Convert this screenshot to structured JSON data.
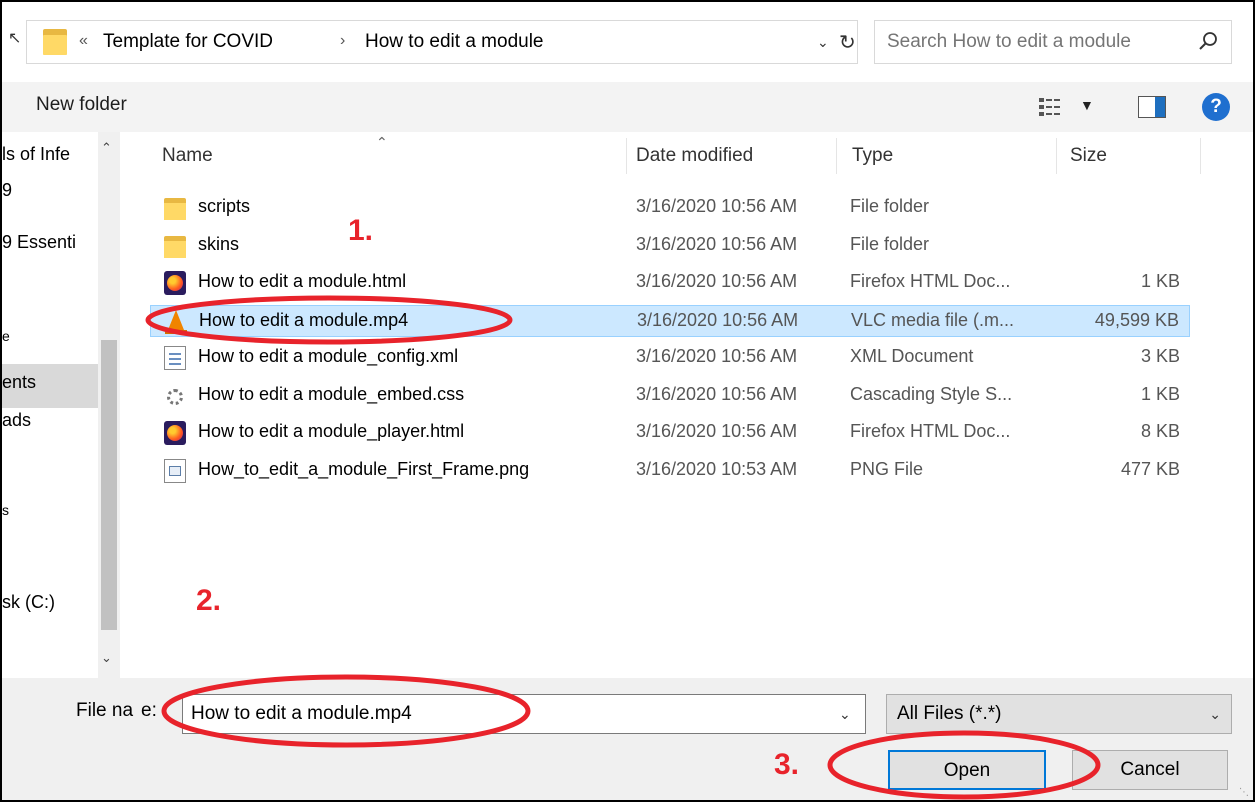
{
  "address": {
    "chevron": "«",
    "crumbs": [
      "Template for COVID",
      "How to edit a module"
    ],
    "separator": "›",
    "refresh_icon": "refresh-icon"
  },
  "search": {
    "placeholder": "Search How to edit a module"
  },
  "toolbar": {
    "new_folder_label": "New folder"
  },
  "nav": {
    "items": [
      {
        "label": "ls of Infe"
      },
      {
        "label": "9"
      },
      {
        "label": "9 Essenti"
      },
      {
        "label": "e"
      },
      {
        "label": "ents"
      },
      {
        "label": "ads"
      },
      {
        "label": "s"
      },
      {
        "label": "sk (C:)"
      }
    ],
    "selected_index": 4
  },
  "columns": {
    "name": "Name",
    "date": "Date modified",
    "type": "Type",
    "size": "Size"
  },
  "files": [
    {
      "name": "scripts",
      "date": "3/16/2020 10:56 AM",
      "type": "File folder",
      "size": "",
      "icon": "folder-icon"
    },
    {
      "name": "skins",
      "date": "3/16/2020 10:56 AM",
      "type": "File folder",
      "size": "",
      "icon": "folder-icon"
    },
    {
      "name": "How to edit a module.html",
      "date": "3/16/2020 10:56 AM",
      "type": "Firefox HTML Doc...",
      "size": "1 KB",
      "icon": "firefox-icon"
    },
    {
      "name": "How to edit a module.mp4",
      "date": "3/16/2020 10:56 AM",
      "type": "VLC media file (.m...",
      "size": "49,599 KB",
      "icon": "vlc-icon"
    },
    {
      "name": "How to edit a module_config.xml",
      "date": "3/16/2020 10:56 AM",
      "type": "XML Document",
      "size": "3 KB",
      "icon": "xml-doc-icon"
    },
    {
      "name": "How to edit a module_embed.css",
      "date": "3/16/2020 10:56 AM",
      "type": "Cascading Style S...",
      "size": "1 KB",
      "icon": "css-file-icon"
    },
    {
      "name": "How to edit a module_player.html",
      "date": "3/16/2020 10:56 AM",
      "type": "Firefox HTML Doc...",
      "size": "8 KB",
      "icon": "firefox-icon"
    },
    {
      "name": "How_to_edit_a_module_First_Frame.png",
      "date": "3/16/2020 10:53 AM",
      "type": "PNG File",
      "size": "477 KB",
      "icon": "image-file-icon"
    }
  ],
  "selected_file_index": 3,
  "footer": {
    "file_name_label": "File na",
    "file_name_label_tail": "e:",
    "file_name_value": "How to edit a module.mp4",
    "file_type": "All Files (*.*)",
    "open_label": "Open",
    "cancel_label": "Cancel"
  },
  "annotations": {
    "step1": "1.",
    "step2": "2.",
    "step3": "3.",
    "color": "#e8232b"
  },
  "colors": {
    "selection_bg": "#cce8ff",
    "selection_border": "#99d1ff",
    "accent": "#0078d7",
    "folder": "#ffd966"
  }
}
